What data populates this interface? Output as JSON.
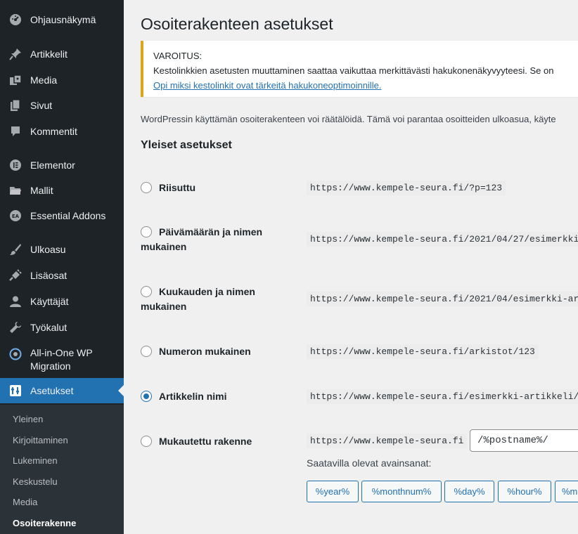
{
  "sidebar": {
    "items": [
      {
        "label": "Ohjausnäkymä",
        "icon": "dashboard-icon"
      },
      {
        "label": "Artikkelit",
        "icon": "pushpin-icon"
      },
      {
        "label": "Media",
        "icon": "media-icon"
      },
      {
        "label": "Sivut",
        "icon": "pages-icon"
      },
      {
        "label": "Kommentit",
        "icon": "comment-icon"
      },
      {
        "label": "Elementor",
        "icon": "elementor-icon"
      },
      {
        "label": "Mallit",
        "icon": "folder-icon"
      },
      {
        "label": "Essential Addons",
        "icon": "essential-addons-icon"
      },
      {
        "label": "Ulkoasu",
        "icon": "brush-icon"
      },
      {
        "label": "Lisäosat",
        "icon": "plugin-icon"
      },
      {
        "label": "Käyttäjät",
        "icon": "users-icon"
      },
      {
        "label": "Työkalut",
        "icon": "wrench-icon"
      },
      {
        "label": "All-in-One WP",
        "label2": "Migration",
        "icon": "migration-icon"
      },
      {
        "label": "Asetukset",
        "icon": "settings-icon"
      }
    ],
    "submenu": [
      "Yleinen",
      "Kirjoittaminen",
      "Lukeminen",
      "Keskustelu",
      "Media",
      "Osoiterakenne"
    ],
    "active_color": "#2271b1"
  },
  "page": {
    "title": "Osoiterakenteen asetukset",
    "notice": {
      "heading": "VAROITUS:",
      "body": "Kestolinkkien asetusten muuttaminen saattaa vaikuttaa merkittävästi hakukonenäkyvyyteesi. Se on",
      "link": "Opi miksi kestolinkit ovat tärkeitä hakukoneoptimoinnille.",
      "border_color": "#dba617"
    },
    "intro": "WordPressin käyttämän osoiterakenteen voi räätälöidä. Tämä voi parantaa osoitteiden ulkoasua, käyte",
    "section_title": "Yleiset asetukset",
    "options": [
      {
        "label": "Riisuttu",
        "url": "https://www.kempele-seura.fi/?p=123",
        "checked": false
      },
      {
        "label": "Päivämäärän ja nimen",
        "label2": "mukainen",
        "url": "https://www.kempele-seura.fi/2021/04/27/esimerkki-",
        "checked": false
      },
      {
        "label": "Kuukauden ja nimen",
        "label2": "mukainen",
        "url": "https://www.kempele-seura.fi/2021/04/esimerkki-art",
        "checked": false
      },
      {
        "label": "Numeron mukainen",
        "url": "https://www.kempele-seura.fi/arkistot/123",
        "checked": false
      },
      {
        "label": "Artikkelin nimi",
        "url": "https://www.kempele-seura.fi/esimerkki-artikkeli/",
        "checked": true
      },
      {
        "label": "Mukautettu rakenne",
        "url": "https://www.kempele-seura.fi",
        "checked": false
      }
    ],
    "custom_structure_value": "/%postname%/",
    "tags_label": "Saatavilla olevat avainsanat:",
    "tags": [
      "%year%",
      "%monthnum%",
      "%day%",
      "%hour%",
      "%m"
    ]
  }
}
